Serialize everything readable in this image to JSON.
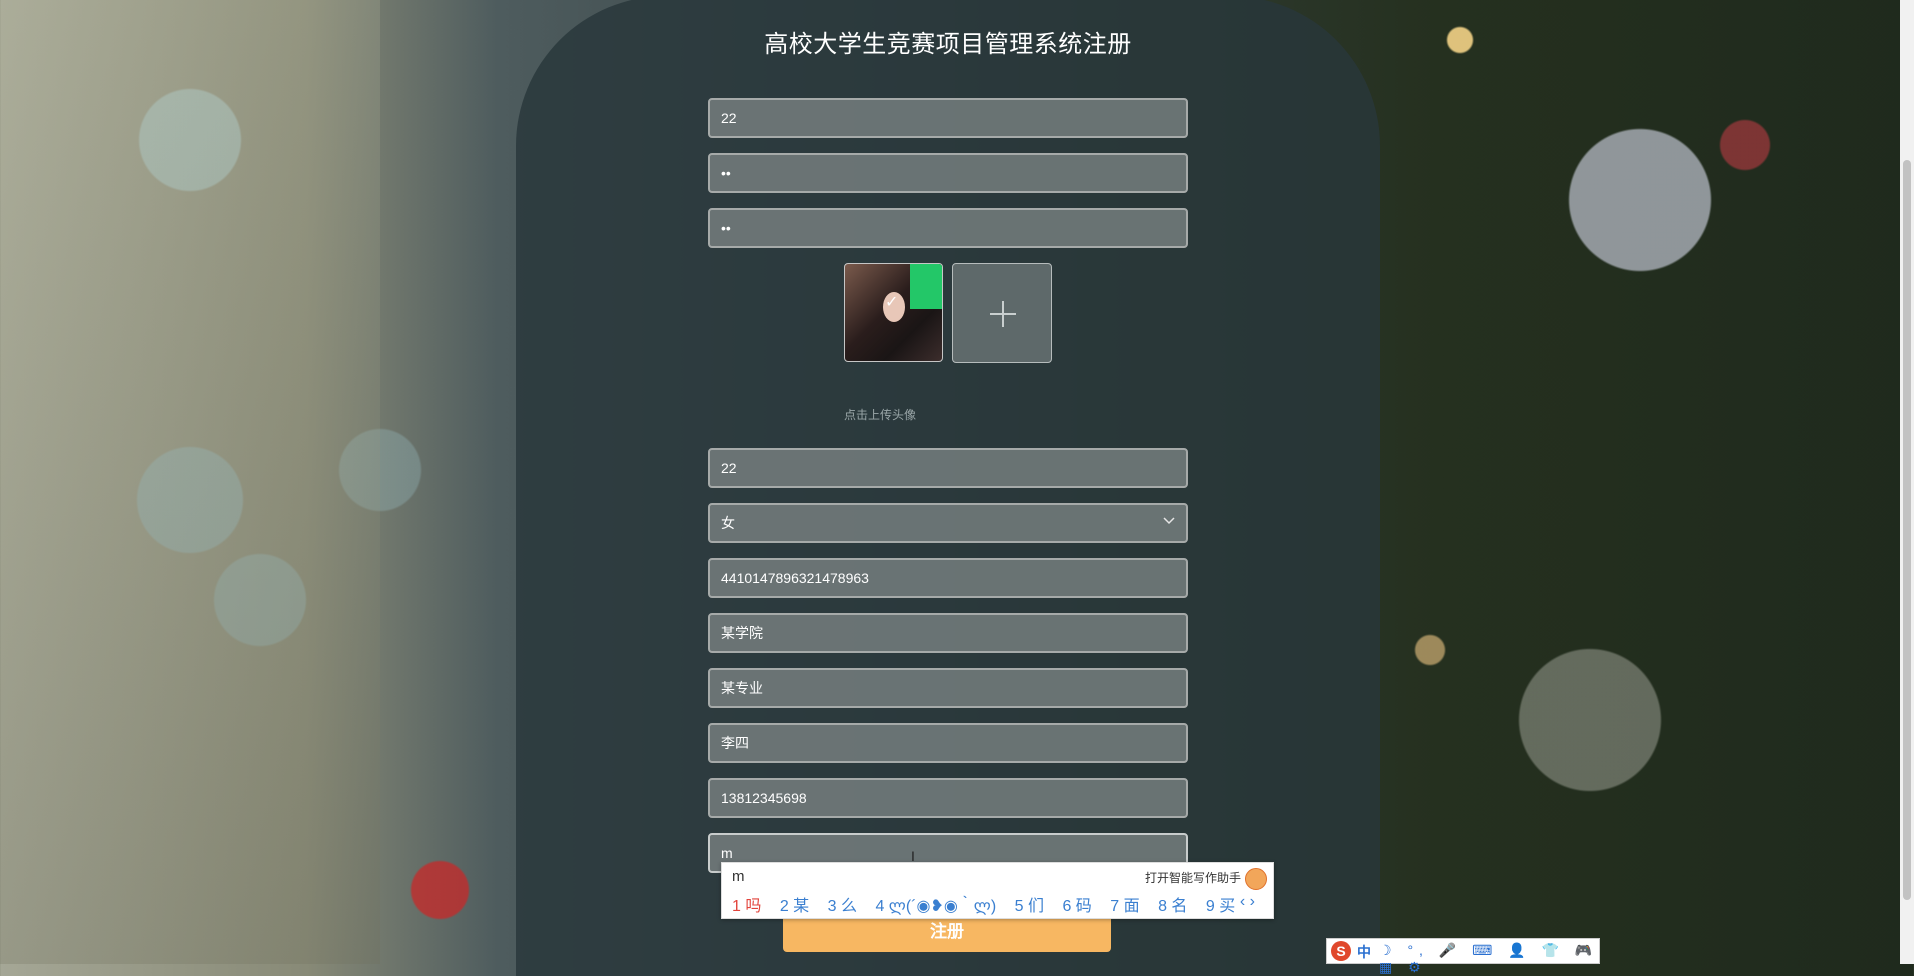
{
  "page": {
    "title": "高校大学生竞赛项目管理系统注册"
  },
  "form": {
    "account": "22",
    "password": "••",
    "confirm_password": "••",
    "upload_hint": "点击上传头像",
    "name": "22",
    "gender": "女",
    "id_number": "4410147896321478963",
    "college": "某学院",
    "major": "某专业",
    "advisor": "李四",
    "phone": "13812345698",
    "email_in_progress": "m",
    "submit_label": "注册"
  },
  "ime_popup": {
    "composition": "m",
    "assistant_label": "打开智能写作助手",
    "candidates": [
      "1 吗",
      "2 某",
      "3 么",
      "4 ლ(´◉❥◉｀ლ)",
      "5 们",
      "6 码",
      "7 面",
      "8 名",
      "9 买"
    ],
    "nav": "‹ ›"
  },
  "ime_toolbar": {
    "logo": "S",
    "mode": "中",
    "tools": "☽ °, 🎤 ⌨ 👤 👕 🎮 ▦ ⚙"
  },
  "colors": {
    "submit": "#f7b762",
    "panel": "#28373a"
  }
}
